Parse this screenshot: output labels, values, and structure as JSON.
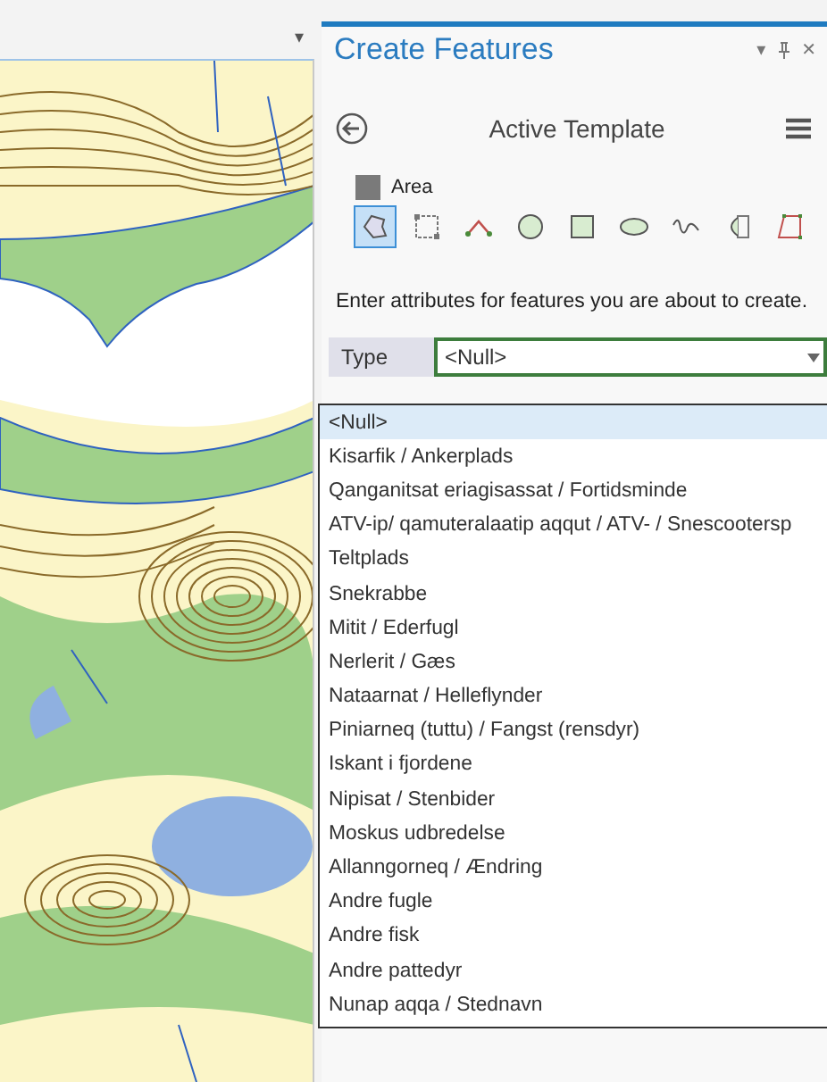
{
  "map_pane": {
    "menu_caret": "▾"
  },
  "panel": {
    "title": "Create Features",
    "controls": [
      "▾",
      "✕"
    ],
    "template_header": "Active Template",
    "template": {
      "name": "Area",
      "color": "#7a7a7a"
    },
    "tools": [
      {
        "kind": "freehand",
        "selected": true
      },
      {
        "kind": "vertices",
        "selected": false
      },
      {
        "kind": "line",
        "selected": false
      },
      {
        "kind": "circle",
        "selected": false
      },
      {
        "kind": "rectangle",
        "selected": false
      },
      {
        "kind": "ellipse",
        "selected": false
      },
      {
        "kind": "trace",
        "selected": false
      },
      {
        "kind": "autocomplete",
        "selected": false
      },
      {
        "kind": "rightangle",
        "selected": false
      }
    ],
    "instructions": "Enter attributes for features you are about to create.",
    "attribute": {
      "label": "Type",
      "value": "<Null>",
      "expanded": true
    },
    "options": [
      {
        "label": "<Null>",
        "selected": true
      },
      {
        "label": "Kisarfik / Ankerplads",
        "selected": false
      },
      {
        "label": "Qanganitsat eriagisassat / Fortidsminde",
        "selected": false
      },
      {
        "label": "ATV-ip/ qamuteralaatip aqqut / ATV- / Snescootersp",
        "selected": false
      },
      {
        "label": "Teltplads",
        "selected": false
      },
      {
        "label": "Snekrabbe",
        "selected": false
      },
      {
        "label": "Mitit / Ederfugl",
        "selected": false
      },
      {
        "label": "Nerlerit / Gæs",
        "selected": false
      },
      {
        "label": "Nataarnat / Helleflynder",
        "selected": false
      },
      {
        "label": "Piniarneq (tuttu) / Fangst (rensdyr)",
        "selected": false
      },
      {
        "label": "Iskant i fjordene",
        "selected": false
      },
      {
        "label": "Nipisat / Stenbider",
        "selected": false
      },
      {
        "label": "Moskus udbredelse",
        "selected": false
      },
      {
        "label": "Allanngorneq / Ændring",
        "selected": false
      },
      {
        "label": "Andre fugle",
        "selected": false
      },
      {
        "label": "Andre fisk",
        "selected": false
      },
      {
        "label": "Andre pattedyr",
        "selected": false
      },
      {
        "label": "Nunap aqqa / Stednavn",
        "selected": false
      }
    ]
  }
}
